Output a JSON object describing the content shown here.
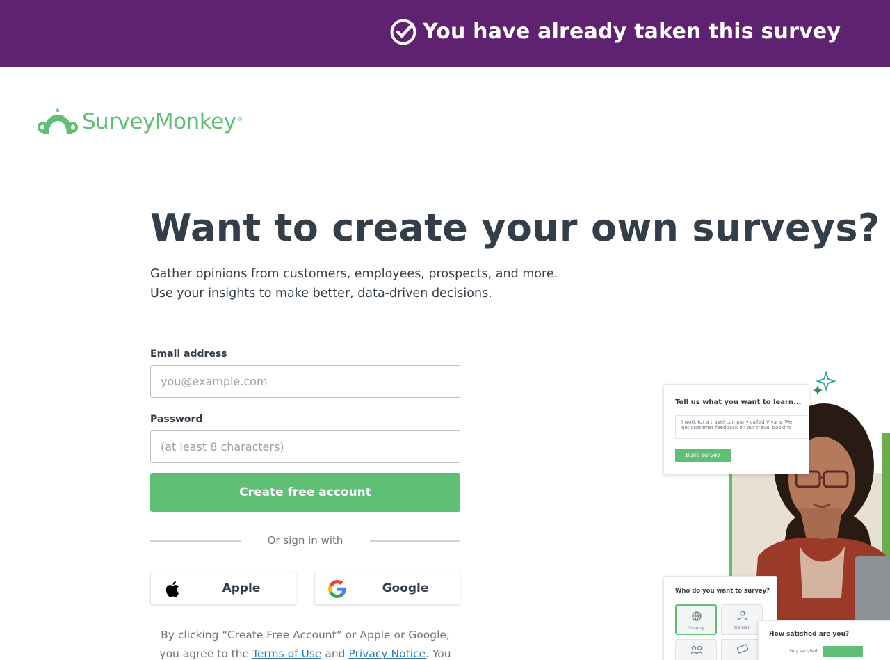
{
  "banner": {
    "message": "You have already taken this survey",
    "background": "#5f2270",
    "icon": "check-circle-icon"
  },
  "logo": {
    "text": "SurveyMonkey",
    "registered": "®",
    "color": "#5fbf74"
  },
  "hero": {
    "headline": "Want to create your own surveys?",
    "line1": "Gather opinions from customers, employees, prospects, and more.",
    "line2": "Use your insights to make better, data-driven decisions."
  },
  "form": {
    "email_label": "Email address",
    "email_placeholder": "you@example.com",
    "password_label": "Password",
    "password_placeholder": "(at least 8 characters)",
    "submit_label": "Create free account",
    "accent": "#5fbf74"
  },
  "social": {
    "divider_text": "Or sign in with",
    "apple_label": "Apple",
    "google_label": "Google"
  },
  "legal": {
    "prefix": "By clicking “Create Free Account” or Apple or Google, you agree to the ",
    "terms_link": "Terms of Use",
    "middle": " and ",
    "privacy_link": "Privacy Notice",
    "suffix": ". You also agree"
  },
  "promo": {
    "card1_title": "Tell us what you want to learn...",
    "card1_input_line1": "I work for a travel company called Vivara. We",
    "card1_input_line2": "get customer feedback on our travel booking",
    "card1_button": "Build survey",
    "card2_title": "Who do you want to survey?",
    "card2_option1": "Country",
    "card2_option2": "Gender",
    "card3_title": "How satisfied are you?",
    "card3_option1": "Very satisfied"
  }
}
